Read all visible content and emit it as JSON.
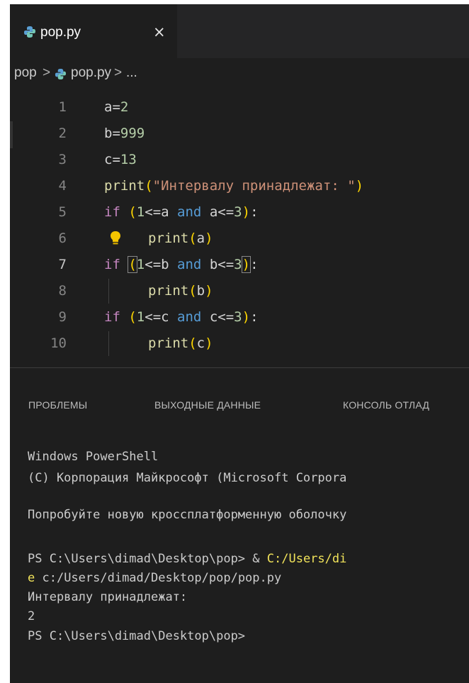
{
  "tab": {
    "label": "pop.py",
    "close": "×"
  },
  "breadcrumb": {
    "folder": "pop",
    "sep1": ">",
    "file": "pop.py",
    "sep2": ">",
    "more": "..."
  },
  "editor": {
    "line_numbers": [
      "1",
      "2",
      "3",
      "4",
      "5",
      "6",
      "7",
      "8",
      "9",
      "10"
    ],
    "lines": {
      "l1": {
        "v": "a",
        "op": "=",
        "n": "2"
      },
      "l2": {
        "v": "b",
        "op": "=",
        "n": "999"
      },
      "l3": {
        "v": "c",
        "op": "=",
        "n": "13"
      },
      "l4": {
        "fn": "print",
        "open": "(",
        "str": "\"Интервалу принадлежат: \"",
        "close": ")"
      },
      "l5": {
        "kw": "if",
        "open": "(",
        "n1": "1",
        "op1": "<=",
        "v1": "a",
        "and": "and",
        "v2": "a",
        "op2": "<=",
        "n2": "3",
        "close": ")",
        "colon": ":"
      },
      "l6": {
        "fn": "print",
        "open": "(",
        "v": "a",
        "close": ")"
      },
      "l7": {
        "kw": "if",
        "open": "(",
        "n1": "1",
        "op1": "<=",
        "v1": "b",
        "and": "and",
        "v2": "b",
        "op2": "<=",
        "n2": "3",
        "close": ")",
        "colon": ":"
      },
      "l8": {
        "fn": "print",
        "open": "(",
        "v": "b",
        "close": ")"
      },
      "l9": {
        "kw": "if",
        "open": "(",
        "n1": "1",
        "op1": "<=",
        "v1": "c",
        "and": "and",
        "v2": "c",
        "op2": "<=",
        "n2": "3",
        "close": ")",
        "colon": ":"
      },
      "l10": {
        "fn": "print",
        "open": "(",
        "v": "c",
        "close": ")"
      }
    }
  },
  "panel": {
    "tabs": [
      "ПРОБЛЕМЫ",
      "ВЫХОДНЫЕ ДАННЫЕ",
      "КОНСОЛЬ ОТЛАД"
    ],
    "terminal": {
      "line1": "Windows PowerShell",
      "line2": "(C) Корпорация Майкрософт (Microsoft Corpora",
      "line3": "Попробуйте новую кроссплатформенную оболочку",
      "line4_prefix": "PS C:\\Users\\dimad\\Desktop\\pop> & ",
      "line4_path": "C:/Users/di",
      "line5_prefix": "e",
      "line5_rest": " c:/Users/dimad/Desktop/pop/pop.py",
      "line6": "Интервалу принадлежат:",
      "line7": "2",
      "line8": "PS C:\\Users\\dimad\\Desktop\\pop>"
    }
  },
  "colors": {
    "editor_bg": "#1e1e1e",
    "keyword_if": "#c586c0",
    "keyword_and": "#569cd6",
    "function": "#dcdcaa",
    "number": "#b5cea8",
    "string": "#ce9178",
    "bracket": "#ffd700",
    "terminal_path": "#f1e35a"
  },
  "icons": [
    "python-file-icon",
    "close-icon",
    "chevron-right-icon",
    "lightbulb-icon"
  ]
}
